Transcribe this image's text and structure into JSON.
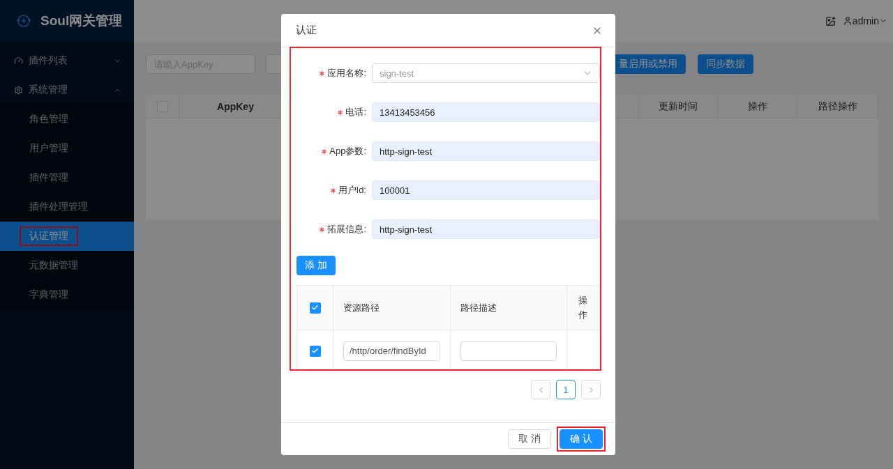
{
  "sidebar": {
    "logo": "Soul网关管理",
    "menu": [
      {
        "label": "插件列表",
        "expanded": false
      },
      {
        "label": "系统管理",
        "expanded": true,
        "children": [
          {
            "label": "角色管理",
            "selected": false,
            "annotated": false
          },
          {
            "label": "用户管理",
            "selected": false,
            "annotated": false
          },
          {
            "label": "插件管理",
            "selected": false,
            "annotated": false
          },
          {
            "label": "插件处理管理",
            "selected": false,
            "annotated": false
          },
          {
            "label": "认证管理",
            "selected": true,
            "annotated": true
          },
          {
            "label": "元数据管理",
            "selected": false,
            "annotated": false
          },
          {
            "label": "字典管理",
            "selected": false,
            "annotated": false
          }
        ]
      }
    ]
  },
  "header": {
    "user": "admin"
  },
  "toolbar": {
    "search_placeholder": "请输入AppKey",
    "buttons": [
      "量启用或禁用",
      "同步数据"
    ]
  },
  "table": {
    "all_checked": false,
    "columns": [
      "AppKey",
      "更新时间",
      "操作",
      "路径操作"
    ]
  },
  "dialog": {
    "title": "认证",
    "annotated": true,
    "fields": [
      {
        "label": "应用名称:",
        "required": true,
        "kind": "select",
        "disabled": true,
        "value": "sign-test"
      },
      {
        "label": "电话:",
        "required": true,
        "kind": "text",
        "value": "13413453456"
      },
      {
        "label": "App参数:",
        "required": true,
        "kind": "text",
        "value": "http-sign-test"
      },
      {
        "label": "用户Id:",
        "required": true,
        "kind": "text",
        "value": "100001"
      },
      {
        "label": "拓展信息:",
        "required": true,
        "kind": "text",
        "value": "http-sign-test"
      }
    ],
    "add_button": "添 加",
    "paths": {
      "all_checked": true,
      "columns": [
        "资源路径",
        "路径描述",
        "操作"
      ],
      "rows": [
        {
          "checked": true,
          "path": "/http/order/findById"
        }
      ]
    },
    "pagination": {
      "pages": [
        {
          "label": "1",
          "selected": true
        }
      ]
    },
    "buttons": [
      {
        "label": "取 消",
        "kind": "default",
        "annotated": false
      },
      {
        "label": "确 认",
        "kind": "primary",
        "annotated": true
      }
    ]
  }
}
